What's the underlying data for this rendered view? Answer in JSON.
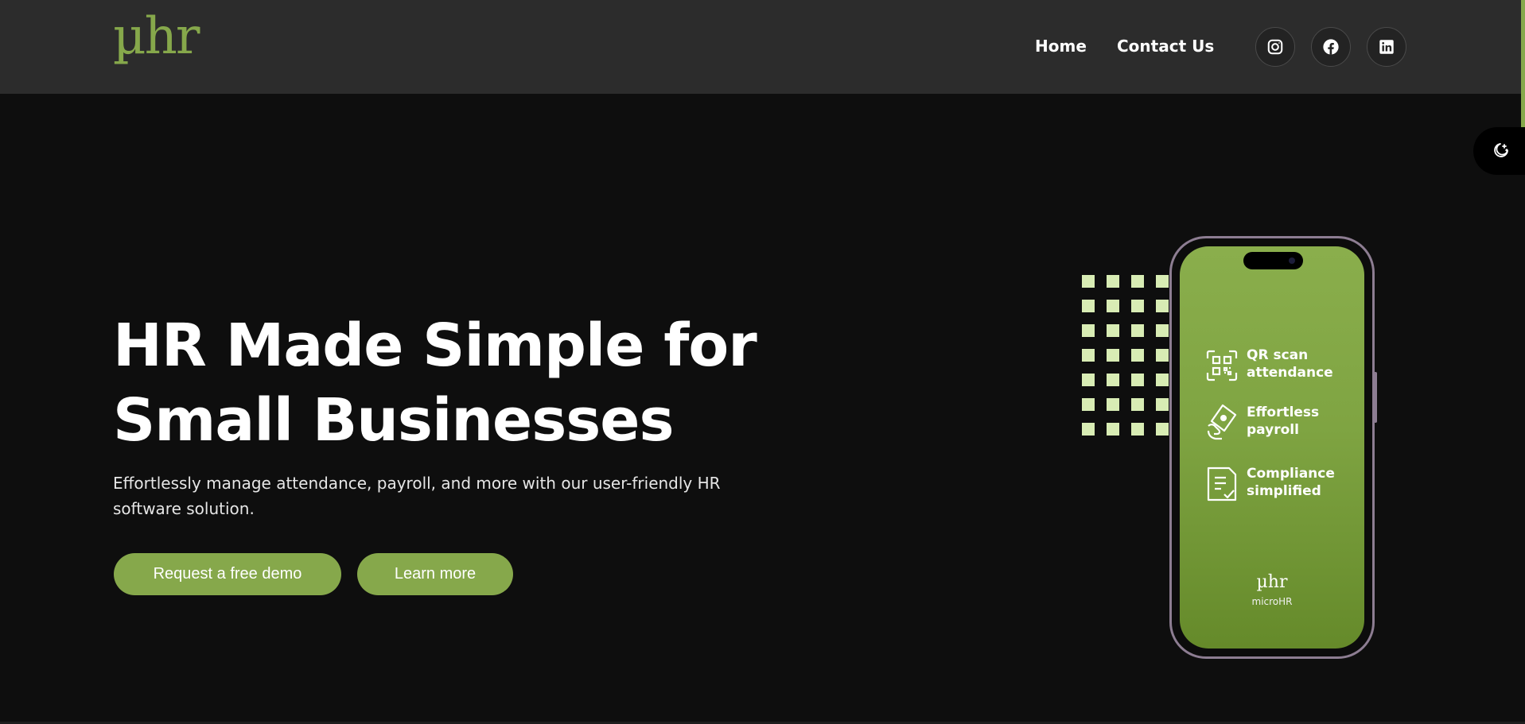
{
  "header": {
    "logo": "µhr",
    "nav": {
      "home": "Home",
      "contact": "Contact Us"
    },
    "social": [
      {
        "icon": "instagram-icon"
      },
      {
        "icon": "facebook-icon"
      },
      {
        "icon": "linkedin-icon"
      }
    ]
  },
  "theme_toggle": {
    "icon": "moon-stars-icon"
  },
  "hero": {
    "title_line1": "HR Made Simple for",
    "title_line2": "Small Businesses",
    "subtitle": "Effortlessly manage attendance, payroll, and more with our user-friendly HR software solution.",
    "demo_button": "Request a free demo",
    "learn_button": "Learn more"
  },
  "phone": {
    "features": [
      {
        "icon": "qr-code-icon",
        "line1": "QR scan",
        "line2": "attendance"
      },
      {
        "icon": "payroll-hand-icon",
        "line1": "Effortless",
        "line2": "payroll"
      },
      {
        "icon": "document-check-icon",
        "line1": "Compliance",
        "line2": "simplified"
      }
    ],
    "logo": "µhr",
    "logo_sub": "microHR"
  },
  "colors": {
    "accent": "#86a84b",
    "header_bg": "#2c2c2c",
    "page_bg": "#0e0e0e",
    "dots": "#d8ecb4"
  }
}
